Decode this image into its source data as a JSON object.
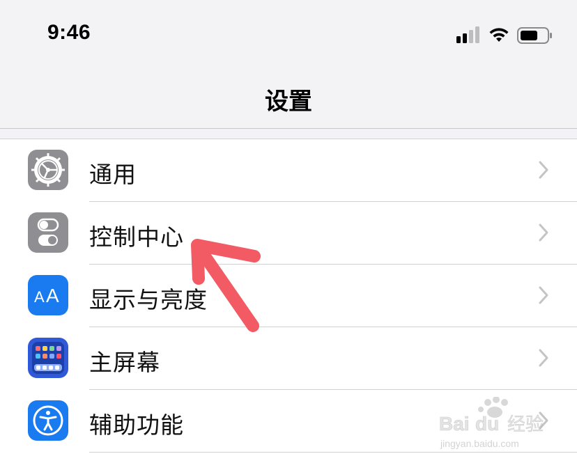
{
  "status_bar": {
    "time": "9:46",
    "signal_icon": "cellular-signal-icon",
    "wifi_icon": "wifi-icon",
    "battery_icon": "battery-icon"
  },
  "nav": {
    "title": "设置"
  },
  "settings": {
    "items": [
      {
        "label": "通用",
        "icon": "gear-icon",
        "icon_bg": "#8e8e93"
      },
      {
        "label": "控制中心",
        "icon": "toggles-icon",
        "icon_bg": "#8e8e93"
      },
      {
        "label": "显示与亮度",
        "icon": "text-size-icon",
        "icon_bg": "#1a7bf0"
      },
      {
        "label": "主屏幕",
        "icon": "home-screen-grid-icon",
        "icon_bg": "#2f59d6"
      },
      {
        "label": "辅助功能",
        "icon": "accessibility-icon",
        "icon_bg": "#1a7bf0"
      }
    ]
  },
  "overlay": {
    "arrow_color": "#f25b63"
  },
  "colors": {
    "header_bg": "#f3f3f6",
    "divider": "#d1d1d6",
    "chevron": "#c4c4c7"
  }
}
